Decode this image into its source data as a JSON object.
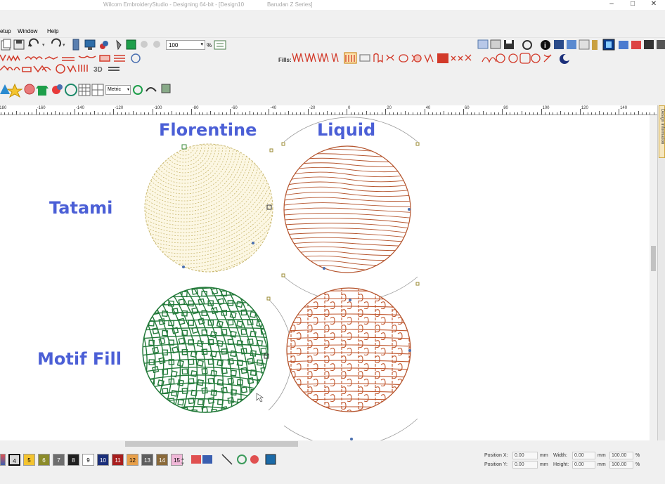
{
  "titlebar": {
    "app_title": "Wilcom EmbroideryStudio - Designing 64-bit - [Design10",
    "machine": "Barudan Z Series]"
  },
  "window_controls": {
    "minimize": "–",
    "maximize": "□",
    "close": "✕"
  },
  "menu": {
    "items": [
      "etup",
      "Window",
      "Help"
    ]
  },
  "toolbar": {
    "zoom_value": "100",
    "zoom_unit": "%",
    "units_value": "Metric",
    "fills_label": "Fills:",
    "three_d_label": "3D"
  },
  "ruler": {
    "ticks": [
      "-180",
      "-160",
      "-140",
      "-120",
      "-100",
      "-80",
      "-60",
      "-40",
      "-20",
      "0",
      "20",
      "40",
      "60",
      "80",
      "100",
      "120",
      "140"
    ]
  },
  "canvas": {
    "labels": {
      "florentine": "Florentine",
      "liquid": "Liquid",
      "tatami": "Tatami",
      "motif": "Motif Fill"
    },
    "colors": {
      "tatami_stitch": "#c9b870",
      "tatami_bg": "#fcf7e3",
      "liquid_stitch": "#b5552e",
      "motif_stitch": "#237a3a",
      "label": "#4b5fd6"
    }
  },
  "sidebar": {
    "tab_label": "Design Information"
  },
  "palette": {
    "swatches": [
      {
        "num": "4",
        "color": "#d9d9d9",
        "selected": true
      },
      {
        "num": "5",
        "color": "#f4c430"
      },
      {
        "num": "6",
        "color": "#8b8b2a"
      },
      {
        "num": "7",
        "color": "#6e6e6e"
      },
      {
        "num": "8",
        "color": "#202020"
      },
      {
        "num": "9",
        "color": "#ffffff"
      },
      {
        "num": "10",
        "color": "#1b2f7a"
      },
      {
        "num": "11",
        "color": "#a81e1e"
      },
      {
        "num": "12",
        "color": "#e8a04a"
      },
      {
        "num": "13",
        "color": "#5e5e5e"
      },
      {
        "num": "14",
        "color": "#8a6a3a"
      },
      {
        "num": "15",
        "color": "#f0b8d8"
      }
    ]
  },
  "status": {
    "position_x_label": "Position X:",
    "position_y_label": "Position Y:",
    "position_x": "0.00",
    "position_y": "0.00",
    "unit": "mm",
    "width_label": "Width:",
    "height_label": "Height:",
    "width": "0.00",
    "height": "0.00",
    "width_pct": "100.00",
    "height_pct": "100.00",
    "pct": "%"
  }
}
